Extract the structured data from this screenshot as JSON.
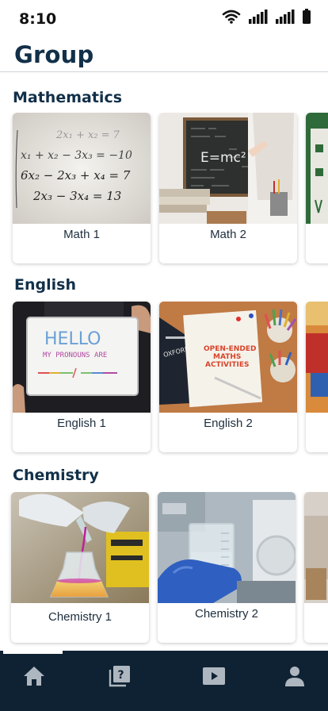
{
  "status": {
    "time": "8:10"
  },
  "title": "Group",
  "sections": [
    {
      "title": "Mathematics",
      "cards": [
        {
          "label": "Math 1"
        },
        {
          "label": "Math 2"
        }
      ]
    },
    {
      "title": "English",
      "cards": [
        {
          "label": "English 1"
        },
        {
          "label": "English 2"
        }
      ]
    },
    {
      "title": "Chemistry",
      "cards": [
        {
          "label": "Chemistry 1"
        },
        {
          "label": "Chemistry 2"
        }
      ]
    }
  ],
  "images": {
    "math1": {
      "equations": [
        "2x₁ + x₂ = 7",
        "x₁ + x₂ − 3x₃ = −10",
        "6x₂ − 2x₃ + x₄ = 7",
        "2x₃ − 3x₄ = 13"
      ]
    },
    "math2": {
      "formula": "E=mc²"
    },
    "english1": {
      "line1": "HELLO",
      "line2": "MY PRONOUNS ARE"
    },
    "english2": {
      "cover1": "OPEN-ENDED",
      "cover2": "MATHS",
      "cover3": "ACTIVITIES",
      "dict": "OXFORD"
    }
  },
  "nav": [
    {
      "icon": "home-icon"
    },
    {
      "icon": "quiz-icon"
    },
    {
      "icon": "video-icon"
    },
    {
      "icon": "profile-icon"
    }
  ],
  "colors": {
    "primary": "#0f2233",
    "title": "#123049"
  }
}
